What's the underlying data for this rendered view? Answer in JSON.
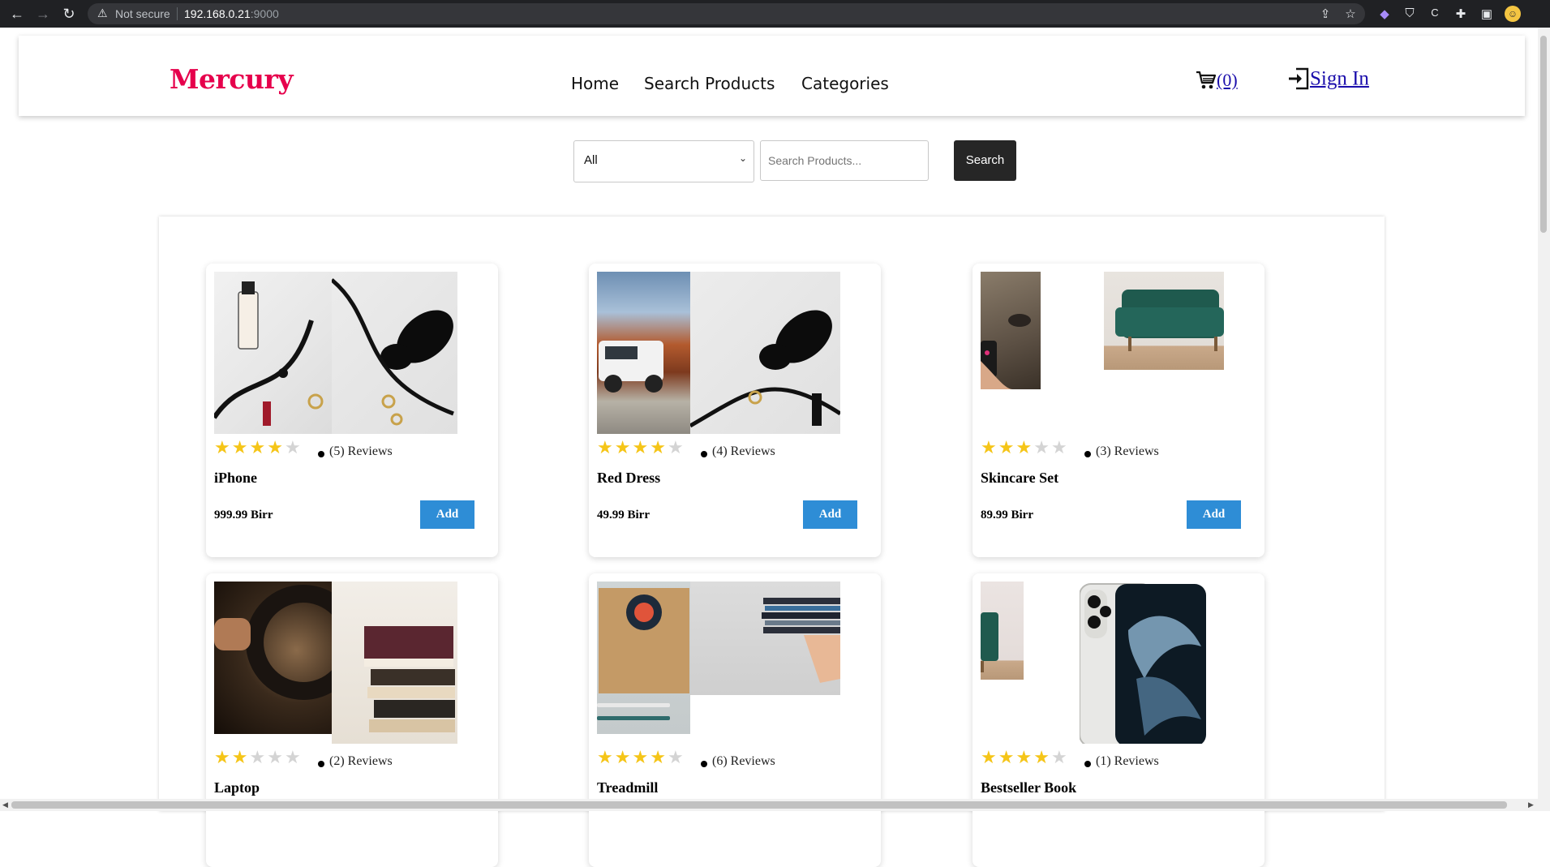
{
  "browser": {
    "security_label": "Not secure",
    "url_host": "192.168.0.21",
    "url_port": ":9000"
  },
  "header": {
    "logo": "Mercury",
    "nav": [
      "Home",
      "Search Products",
      "Categories"
    ],
    "cart_count": "(0)",
    "signin_label": "Sign In"
  },
  "search": {
    "category_value": "All",
    "placeholder": "Search Products...",
    "button_label": "Search"
  },
  "products": [
    {
      "name": "iPhone",
      "rating": 4,
      "reviews": "(5) Reviews",
      "price": "999.99 Birr",
      "add_label": "Add"
    },
    {
      "name": "Red Dress",
      "rating": 4,
      "reviews": "(4) Reviews",
      "price": "49.99 Birr",
      "add_label": "Add"
    },
    {
      "name": "Skincare Set",
      "rating": 3,
      "reviews": "(3) Reviews",
      "price": "89.99 Birr",
      "add_label": "Add"
    },
    {
      "name": "Laptop",
      "rating": 2,
      "reviews": "(2) Reviews",
      "price": "",
      "add_label": ""
    },
    {
      "name": "Treadmill",
      "rating": 4,
      "reviews": "(6) Reviews",
      "price": "",
      "add_label": ""
    },
    {
      "name": "Bestseller Book",
      "rating": 4,
      "reviews": "(1) Reviews",
      "price": "",
      "add_label": ""
    }
  ],
  "colors": {
    "brand": "#e6004c",
    "add_button": "#2e8dd6",
    "search_button": "#262626",
    "star": "#f5c518"
  }
}
